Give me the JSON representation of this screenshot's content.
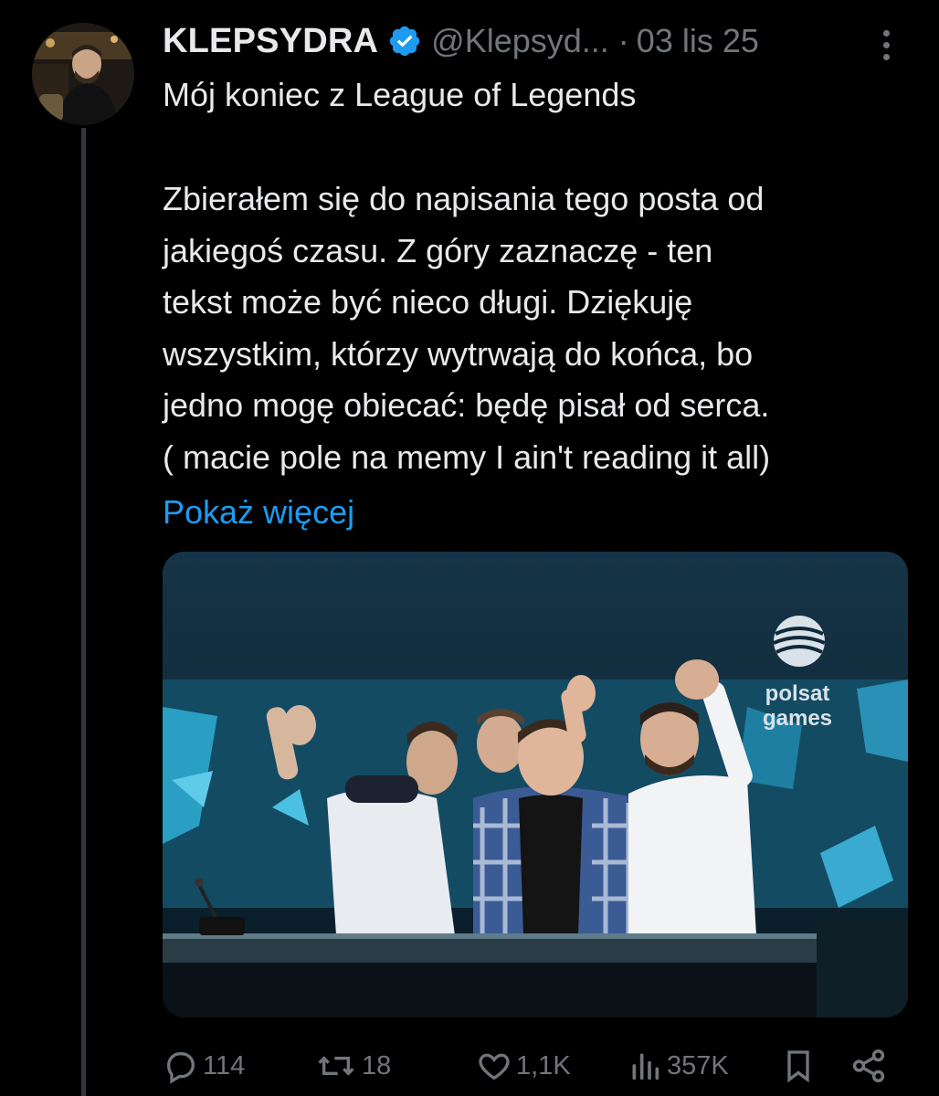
{
  "post": {
    "author": {
      "display_name": "KLEPSYDRA",
      "handle": "@Klepsyd...",
      "verified": true
    },
    "separator": "·",
    "date": "03 lis 25",
    "title": "Mój koniec z League of Legends",
    "body_lines": [
      "Zbierałem się do napisania tego posta od",
      "jakiegoś czasu. Z góry zaznaczę - ten",
      "tekst może być nieco długi. Dziękuję",
      "wszystkim, którzy wytrwają do końca, bo",
      "jedno mogę obiecać: będę pisał od serca.",
      "( macie pole na memy I ain't reading it all)"
    ],
    "show_more": "Pokaż więcej",
    "media": {
      "watermark_line1": "polsat",
      "watermark_line2": "games"
    },
    "stats": {
      "replies": "114",
      "reposts": "18",
      "likes": "1,1K",
      "views": "357K"
    }
  },
  "icons": {
    "verified": "verified-badge-icon",
    "more": "more-vertical-icon",
    "reply": "reply-icon",
    "repost": "repost-icon",
    "like": "heart-icon",
    "views": "views-icon",
    "bookmark": "bookmark-icon",
    "share": "share-icon"
  },
  "colors": {
    "background": "#000000",
    "text": "#e7e9ea",
    "secondary": "#71767b",
    "link": "#1d9bf0",
    "verified": "#1d9bf0"
  }
}
